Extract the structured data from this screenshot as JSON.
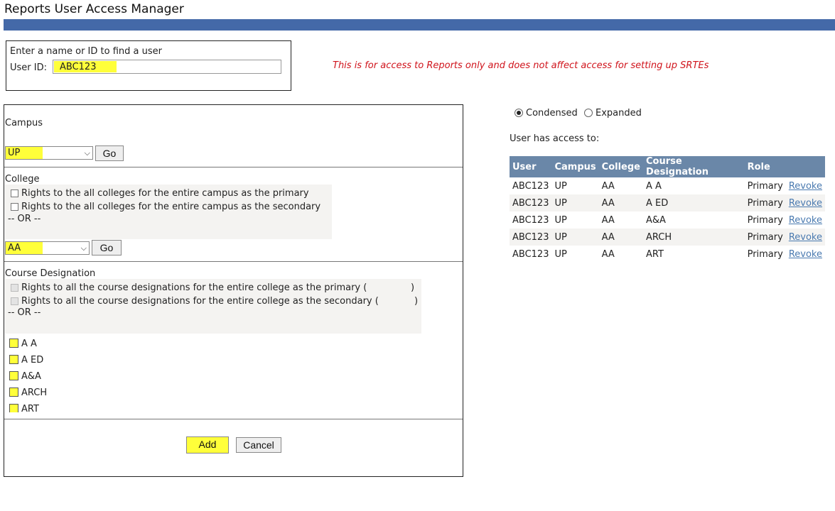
{
  "page": {
    "title": "Reports User Access Manager",
    "notice": "This is for access to Reports only and does not affect access for setting up SRTEs"
  },
  "lookup": {
    "prompt": "Enter a name or ID to find a user",
    "userid_label": "User ID:",
    "userid_value": "ABC123"
  },
  "campus": {
    "label": "Campus",
    "selected": "UP",
    "go_label": "Go"
  },
  "college": {
    "label": "College",
    "rights_primary": "Rights to the all colleges for the entire campus as the primary",
    "rights_secondary": "Rights to the all colleges for the entire campus as the secondary",
    "or": "-- OR --",
    "selected": "AA",
    "go_label": "Go"
  },
  "course": {
    "label": "Course Designation",
    "rights_primary": "Rights to all the course designations for the entire college as the primary (",
    "rights_primary_close": ")",
    "rights_secondary": "Rights to all the course designations for the entire college as the secondary (",
    "rights_secondary_close": ")",
    "or": "-- OR --",
    "items": [
      "A A",
      "A ED",
      "A&A",
      "ARCH",
      "ART"
    ]
  },
  "actions": {
    "add_label": "Add",
    "cancel_label": "Cancel"
  },
  "view": {
    "condensed_label": "Condensed",
    "expanded_label": "Expanded",
    "selected": "Condensed"
  },
  "access": {
    "heading": "User has access to:",
    "columns": [
      "User",
      "Campus",
      "College",
      "Course Designation",
      "Role"
    ],
    "rows": [
      {
        "user": "ABC123",
        "campus": "UP",
        "college": "AA",
        "course": "A A",
        "role": "Primary",
        "action": "Revoke"
      },
      {
        "user": "ABC123",
        "campus": "UP",
        "college": "AA",
        "course": "A ED",
        "role": "Primary",
        "action": "Revoke"
      },
      {
        "user": "ABC123",
        "campus": "UP",
        "college": "AA",
        "course": "A&A",
        "role": "Primary",
        "action": "Revoke"
      },
      {
        "user": "ABC123",
        "campus": "UP",
        "college": "AA",
        "course": "ARCH",
        "role": "Primary",
        "action": "Revoke"
      },
      {
        "user": "ABC123",
        "campus": "UP",
        "college": "AA",
        "course": "ART",
        "role": "Primary",
        "action": "Revoke"
      }
    ]
  },
  "colors": {
    "title_bar": "#4469a8",
    "highlight": "#ffff3a",
    "table_header": "#6a87a8",
    "notice": "#d0141c",
    "link": "#4a7ab0"
  }
}
